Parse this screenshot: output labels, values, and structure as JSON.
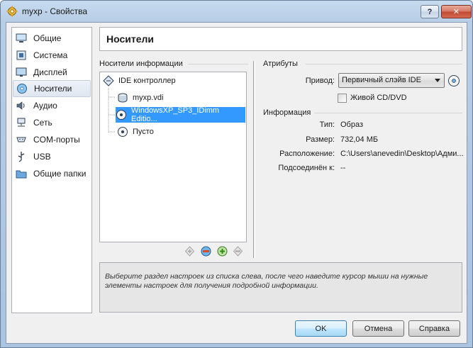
{
  "window": {
    "title": "myxp - Свойства",
    "help_label": "?",
    "close_label": "✕"
  },
  "sidebar": {
    "items": [
      {
        "label": "Общие",
        "icon": "general-icon"
      },
      {
        "label": "Система",
        "icon": "system-icon"
      },
      {
        "label": "Дисплей",
        "icon": "display-icon"
      },
      {
        "label": "Носители",
        "icon": "storage-icon",
        "selected": true
      },
      {
        "label": "Аудио",
        "icon": "audio-icon"
      },
      {
        "label": "Сеть",
        "icon": "network-icon"
      },
      {
        "label": "COM-порты",
        "icon": "serial-ports-icon"
      },
      {
        "label": "USB",
        "icon": "usb-icon"
      },
      {
        "label": "Общие папки",
        "icon": "shared-folders-icon"
      }
    ]
  },
  "header": {
    "title": "Носители"
  },
  "storage": {
    "group_label": "Носители информации",
    "tree": [
      {
        "label": "IDE контроллер",
        "kind": "controller"
      },
      {
        "label": "myxp.vdi",
        "kind": "disk"
      },
      {
        "label": "WindowsXP_SP3_IDimm Editio...",
        "kind": "cd",
        "selected": true
      },
      {
        "label": "Пусто",
        "kind": "cd"
      }
    ]
  },
  "attributes": {
    "group_label": "Атрибуты",
    "drive_label": "Привод:",
    "drive_value": "Первичный слэйв IDE",
    "live_cd_label": "Живой CD/DVD",
    "live_cd_checked": false
  },
  "information": {
    "group_label": "Информация",
    "rows": [
      {
        "label": "Тип:",
        "value": "Образ"
      },
      {
        "label": "Размер:",
        "value": "732,04 МБ"
      },
      {
        "label": "Расположение:",
        "value": "C:\\Users\\anevedin\\Desktop\\Адми..."
      },
      {
        "label": "Подсоединён к:",
        "value": "--"
      }
    ]
  },
  "hint": {
    "text": "Выберите раздел настроек из списка слева, после чего наведите курсор мыши на нужные элементы настроек для получения подробной информации."
  },
  "buttons": {
    "ok": "OK",
    "cancel": "Отмена",
    "help": "Справка"
  },
  "colors": {
    "selection": "#3399ff",
    "title_gradient": "#b7cde6",
    "close_red": "#c1482f"
  }
}
